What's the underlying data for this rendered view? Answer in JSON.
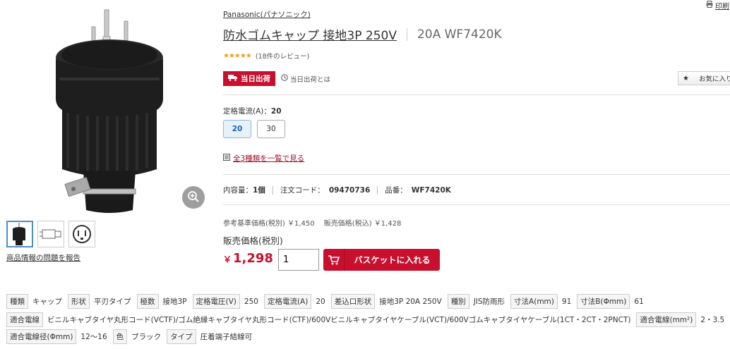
{
  "print_label": "印刷",
  "brand": "Panasonic(パナソニック)",
  "title": {
    "main": "防水ゴムキャップ 接地3P 250V",
    "model": "20A WF7420K"
  },
  "rating": {
    "stars": "★★★★★",
    "reviews": "(18件のレビュー)"
  },
  "same_day": {
    "badge": "当日出荷",
    "help": "当日出荷とは"
  },
  "favorite_label": "お気に入り",
  "rated_current": {
    "label": "定格電流(A)：",
    "value": "20",
    "options": [
      "20",
      "30"
    ]
  },
  "all_types_link": "全3種類を一覧で見る",
  "meta": {
    "content_label": "内容量：",
    "content_value": "1個",
    "order_code_label": "注文コード：",
    "order_code_value": "09470736",
    "part_no_label": "品番：",
    "part_no_value": "WF7420K"
  },
  "ref_price": "参考基準価格(税別) ￥1,450　 販売価格(税込) ￥1,428",
  "sale_label": "販売価格(税別)",
  "price_symbol": "￥",
  "price_value": "1,298",
  "quantity": "1",
  "cart_button": "バスケットに入れる",
  "report_link": "商品情報の問題を報告",
  "specs": [
    [
      {
        "k": "種類",
        "v": "キャップ"
      },
      {
        "k": "形状",
        "v": "平刃タイプ"
      },
      {
        "k": "極数",
        "v": "接地3P"
      },
      {
        "k": "定格電圧(V)",
        "v": "250"
      },
      {
        "k": "定格電流(A)",
        "v": "20"
      },
      {
        "k": "差込口形状",
        "v": "接地3P 20A 250V"
      },
      {
        "k": "種別",
        "v": "JIS防雨形"
      },
      {
        "k": "寸法A(mm)",
        "v": "91"
      },
      {
        "k": "寸法B(Φmm)",
        "v": "61"
      }
    ],
    [
      {
        "k": "適合電線",
        "v": "ビニルキャブタイヤ丸形コード(VCTF)/ゴム絶縁キャブタイヤ丸形コード(CTF)/600Vビニルキャブタイヤケーブル(VCT)/600Vゴムキャブタイヤケーブル(1CT・2CT・2PNCT)"
      },
      {
        "k": "適合電線(mm²)",
        "v": "2・3.5"
      }
    ],
    [
      {
        "k": "適合電線径(Φmm)",
        "v": "12～16"
      },
      {
        "k": "色",
        "v": "ブラック"
      },
      {
        "k": "タイプ",
        "v": "圧着端子結線可"
      }
    ]
  ]
}
